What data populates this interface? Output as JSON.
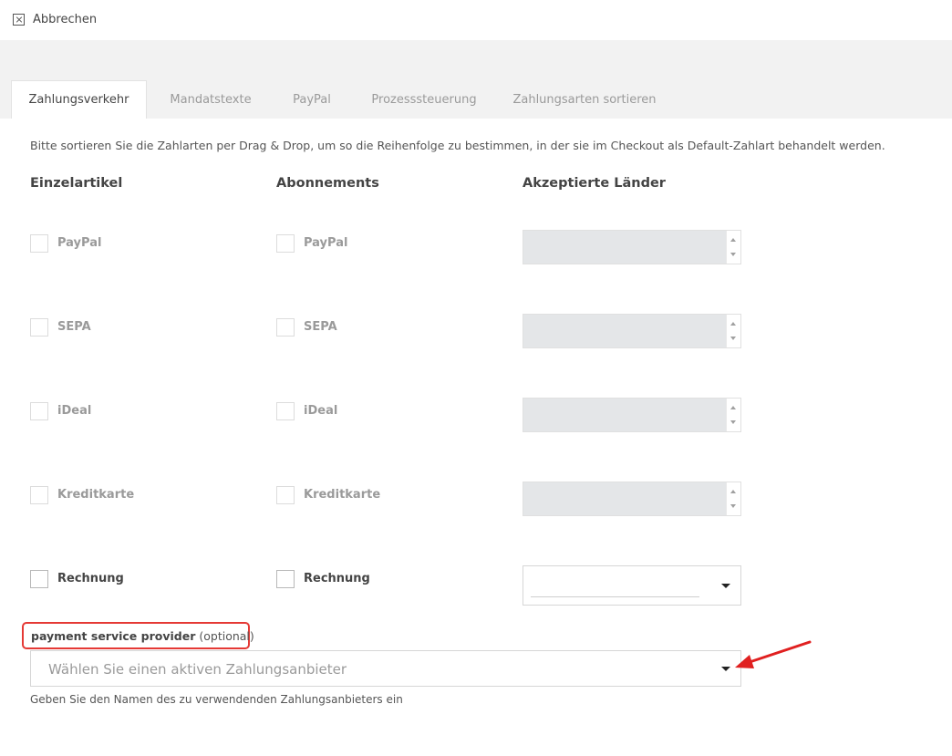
{
  "topbar": {
    "cancel_label": "Abbrechen"
  },
  "tabs": [
    {
      "label": "Zahlungsverkehr",
      "active": true
    },
    {
      "label": "Mandatstexte",
      "active": false
    },
    {
      "label": "PayPal",
      "active": false
    },
    {
      "label": "Prozesssteuerung",
      "active": false
    },
    {
      "label": "Zahlungsarten sortieren",
      "active": false
    }
  ],
  "intro_text": "Bitte sortieren Sie die Zahlarten per Drag & Drop, um so die Reihenfolge zu bestimmen, in der sie im Checkout als Default-Zahlart behandelt werden.",
  "columns": {
    "single": "Einzelartikel",
    "subscription": "Abonnements",
    "countries": "Akzeptierte Länder"
  },
  "payment_methods": [
    {
      "label": "PayPal",
      "enabled": false,
      "single_checked": false,
      "subscription_checked": false
    },
    {
      "label": "SEPA",
      "enabled": false,
      "single_checked": false,
      "subscription_checked": false
    },
    {
      "label": "iDeal",
      "enabled": false,
      "single_checked": false,
      "subscription_checked": false
    },
    {
      "label": "Kreditkarte",
      "enabled": false,
      "single_checked": false,
      "subscription_checked": false
    },
    {
      "label": "Rechnung",
      "enabled": true,
      "single_checked": false,
      "subscription_checked": false
    }
  ],
  "psp": {
    "label": "payment service provider",
    "optional": "(optional)",
    "placeholder": "Wählen Sie einen aktiven Zahlungsanbieter",
    "help": "Geben Sie den Namen des zu verwendenden Zahlungsanbieters ein"
  },
  "colors": {
    "highlight_box": "#e53935",
    "annotation_arrow": "#e02020",
    "disabled_select": "#e4e6e8",
    "header_strip": "#f2f2f2"
  }
}
